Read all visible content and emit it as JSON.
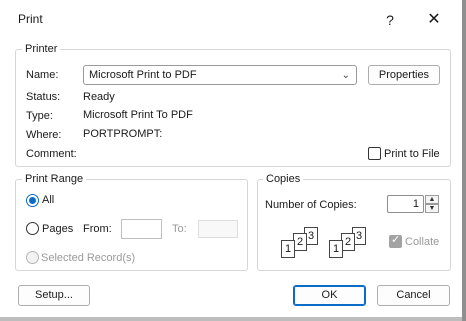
{
  "window": {
    "title": "Print",
    "help_glyph": "?",
    "close_glyph": "✕"
  },
  "printer": {
    "group_label": "Printer",
    "name_label": "Name:",
    "name_value": "Microsoft Print to PDF",
    "properties_button": "Properties",
    "status_label": "Status:",
    "status_value": "Ready",
    "type_label": "Type:",
    "type_value": "Microsoft Print To PDF",
    "where_label": "Where:",
    "where_value": "PORTPROMPT:",
    "comment_label": "Comment:",
    "print_to_file_label": "Print to File"
  },
  "print_range": {
    "group_label": "Print Range",
    "all_label": "All",
    "pages_label": "Pages",
    "from_label": "From:",
    "to_label": "To:",
    "selected_records_label": "Selected Record(s)",
    "selected_option": "All"
  },
  "copies": {
    "group_label": "Copies",
    "number_label": "Number of Copies:",
    "number_value": "1",
    "collate_label": "Collate",
    "collate_checked": true,
    "collate_pages": [
      "1",
      "2",
      "3"
    ]
  },
  "footer": {
    "setup_button": "Setup...",
    "ok_button": "OK",
    "cancel_button": "Cancel"
  },
  "colors": {
    "accent": "#0b6cc7",
    "group_border": "#d6d6d6",
    "disabled": "#9a9a9a"
  },
  "icons": {
    "help": "help-icon",
    "close": "close-icon",
    "dropdown": "chevron-down-icon",
    "spin_up": "spin-up-icon",
    "spin_down": "spin-down-icon",
    "collate": "collate-pages-icon"
  }
}
